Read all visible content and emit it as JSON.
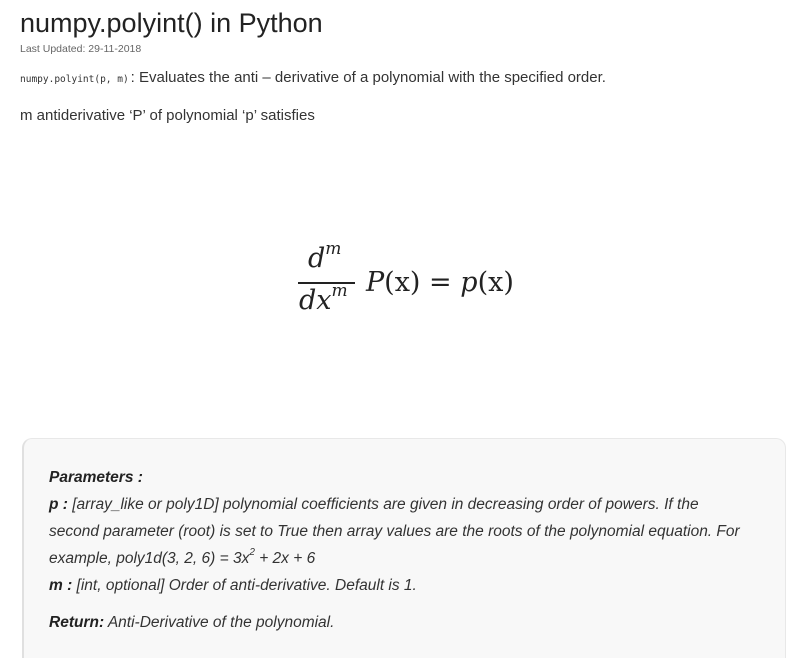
{
  "article": {
    "title": "numpy.polyint() in Python",
    "last_updated": "Last Updated: 29-11-2018",
    "intro_code": "numpy.polyint(p, m)",
    "intro_text": ": Evaluates the anti – derivative of a polynomial with the specified order.",
    "antiderivative_text": "m antiderivative ‘P’ of polynomial ‘p’ satisfies"
  },
  "formula": {
    "num_d": "d",
    "num_exp": "m",
    "den_dx": "dx",
    "den_exp": "m",
    "lhs_fn": "P",
    "lhs_arg": "(x)",
    "equals": " = ",
    "rhs_fn": "p",
    "rhs_arg": "(x)"
  },
  "parameters": {
    "heading": "Parameters :",
    "p_label": "p :",
    "p_line1": " [array_like or poly1D] polynomial coefficients are given in decreasing order of powers. If the",
    "p_line2": "second parameter (root) is set to True then array values are the roots of the polynomial equation. For",
    "p_line3_pre": "example, poly1d(3, 2, 6) = 3x",
    "p_line3_sup": "2",
    "p_line3_post": " + 2x + 6",
    "m_label": "m :",
    "m_text": " [int, optional] Order of anti-derivative. Default is 1.",
    "return_label": "Return:",
    "return_text": " Anti-Derivative of the polynomial."
  }
}
